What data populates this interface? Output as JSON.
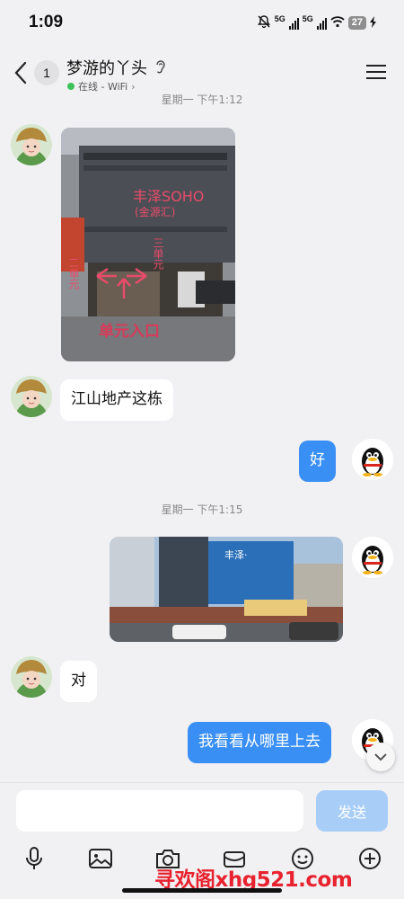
{
  "status_bar": {
    "time": "1:09",
    "network_1": "5G",
    "network_2": "5G",
    "battery": "27"
  },
  "header": {
    "unread_count": "1",
    "contact_name": "梦游的丫头",
    "online_status": "在线 - WiFi"
  },
  "messages": [
    {
      "type": "timestamp",
      "text": "星期一 下午1:12"
    },
    {
      "type": "image",
      "side": "in",
      "caption_sign": "丰泽SOHO",
      "caption_sub": "(金源汇)",
      "label_left": "二单元",
      "label_right": "三单元",
      "label_entrance": "单元入口"
    },
    {
      "type": "text",
      "side": "in",
      "text": "江山地产这栋"
    },
    {
      "type": "text",
      "side": "out",
      "text": "好"
    },
    {
      "type": "timestamp",
      "text": "星期一 下午1:15"
    },
    {
      "type": "image",
      "side": "out",
      "caption_sign": "丰泽·"
    },
    {
      "type": "text",
      "side": "in",
      "text": "对"
    },
    {
      "type": "text",
      "side": "out",
      "text": "我看看从哪里上去"
    }
  ],
  "composer": {
    "placeholder": "",
    "send_label": "发送"
  },
  "toolbar": [
    "microphone-icon",
    "image-icon",
    "camera-icon",
    "red-packet-icon",
    "emoji-icon",
    "plus-icon"
  ],
  "watermark": "寻欢阁xhg521.com",
  "colors": {
    "accent": "#3a8ff5",
    "send_disabled": "#a8cef8",
    "online": "#3cc25a",
    "watermark": "#e8222e"
  }
}
